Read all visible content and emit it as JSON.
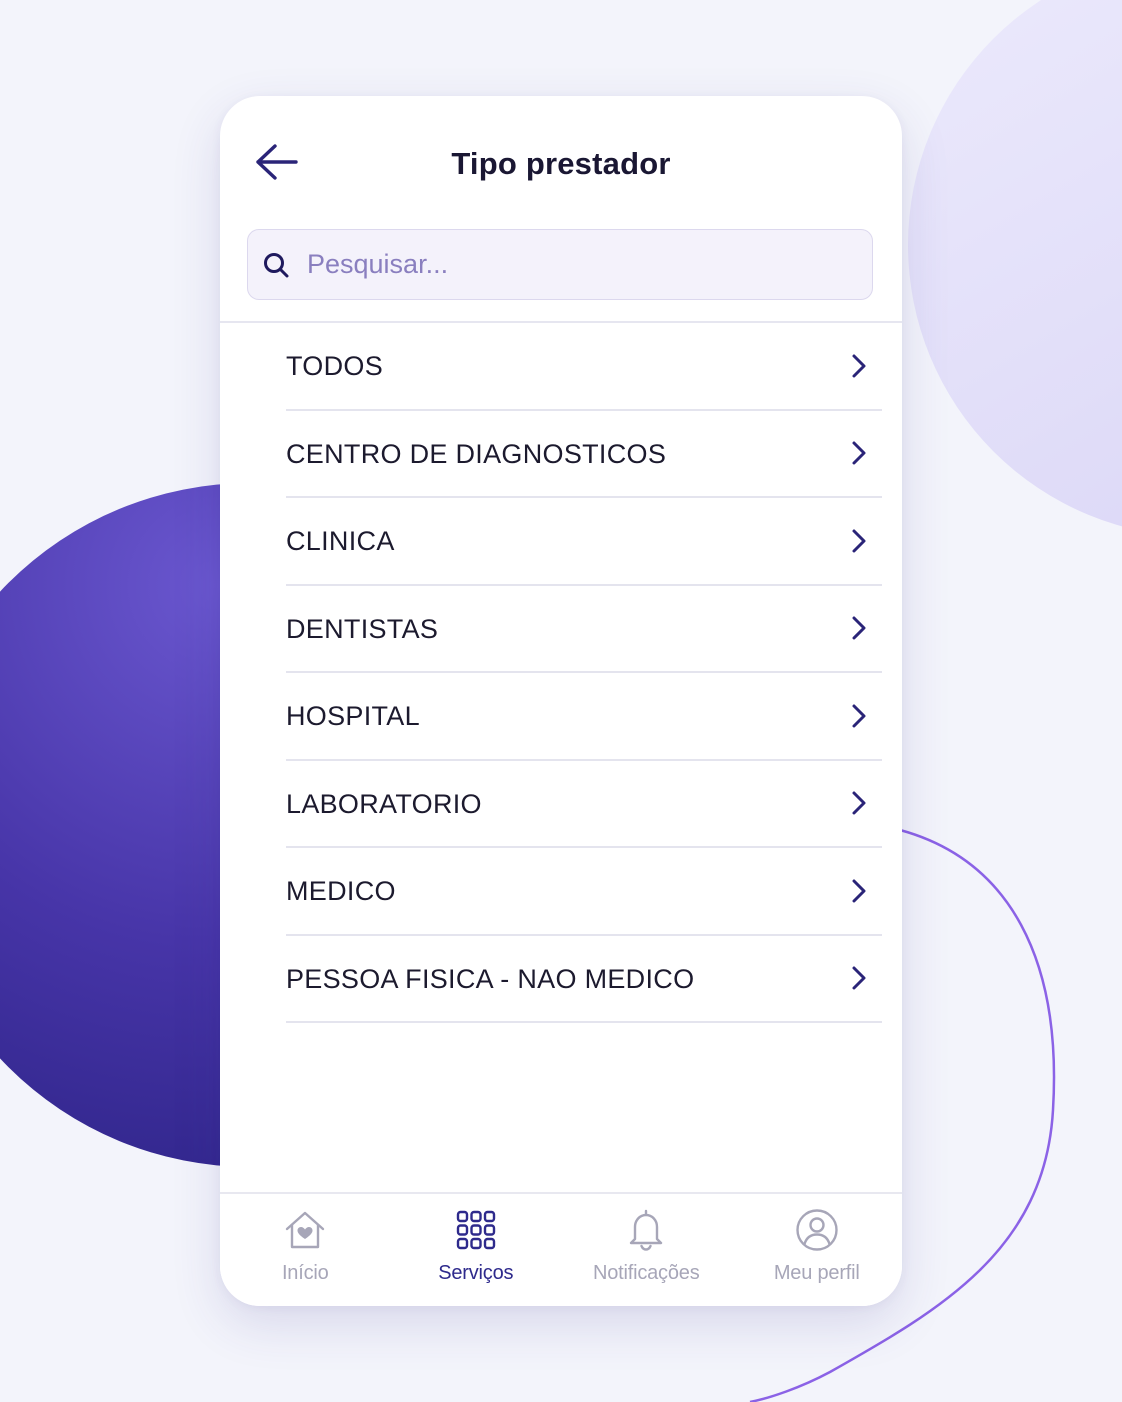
{
  "header": {
    "title": "Tipo prestador",
    "back_icon": "arrow-left-icon"
  },
  "search": {
    "placeholder": "Pesquisar...",
    "value": "",
    "icon": "search-icon"
  },
  "list": {
    "items": [
      {
        "label": "TODOS"
      },
      {
        "label": "CENTRO DE DIAGNOSTICOS"
      },
      {
        "label": "CLINICA"
      },
      {
        "label": "DENTISTAS"
      },
      {
        "label": "HOSPITAL"
      },
      {
        "label": "LABORATORIO"
      },
      {
        "label": "MEDICO"
      },
      {
        "label": "PESSOA FISICA - NAO MEDICO"
      }
    ],
    "chevron_icon": "chevron-right-icon"
  },
  "bottom_nav": {
    "items": [
      {
        "label": "Início",
        "icon": "home-heart-icon",
        "active": false
      },
      {
        "label": "Serviços",
        "icon": "grid-icon",
        "active": true
      },
      {
        "label": "Notificações",
        "icon": "bell-icon",
        "active": false
      },
      {
        "label": "Meu perfil",
        "icon": "user-circle-icon",
        "active": false
      }
    ]
  },
  "colors": {
    "accent": "#2e2a8c",
    "text": "#1c1a2e",
    "inactive": "#a7a6b8",
    "search_bg": "#f4f2fb",
    "background": "#f3f4fb"
  }
}
